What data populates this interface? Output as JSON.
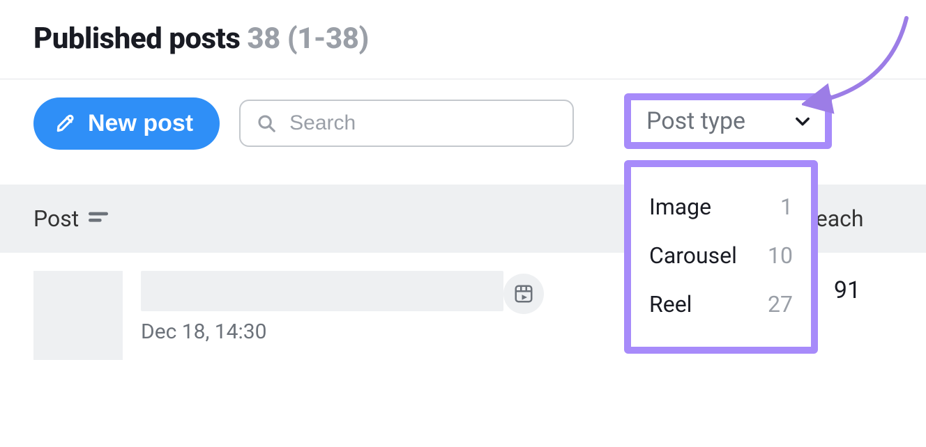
{
  "header": {
    "title": "Published posts",
    "count_text": "38 (1-38)"
  },
  "toolbar": {
    "new_post_label": "New post",
    "search_placeholder": "Search",
    "filter": {
      "label": "Post type",
      "options": [
        {
          "name": "Image",
          "count": "1"
        },
        {
          "name": "Carousel",
          "count": "10"
        },
        {
          "name": "Reel",
          "count": "27"
        }
      ]
    }
  },
  "table": {
    "columns": {
      "post": "Post",
      "reach": "Reach"
    },
    "rows": [
      {
        "timestamp": "Dec 18, 14:30",
        "reach": "91",
        "type": "reel"
      }
    ]
  }
}
